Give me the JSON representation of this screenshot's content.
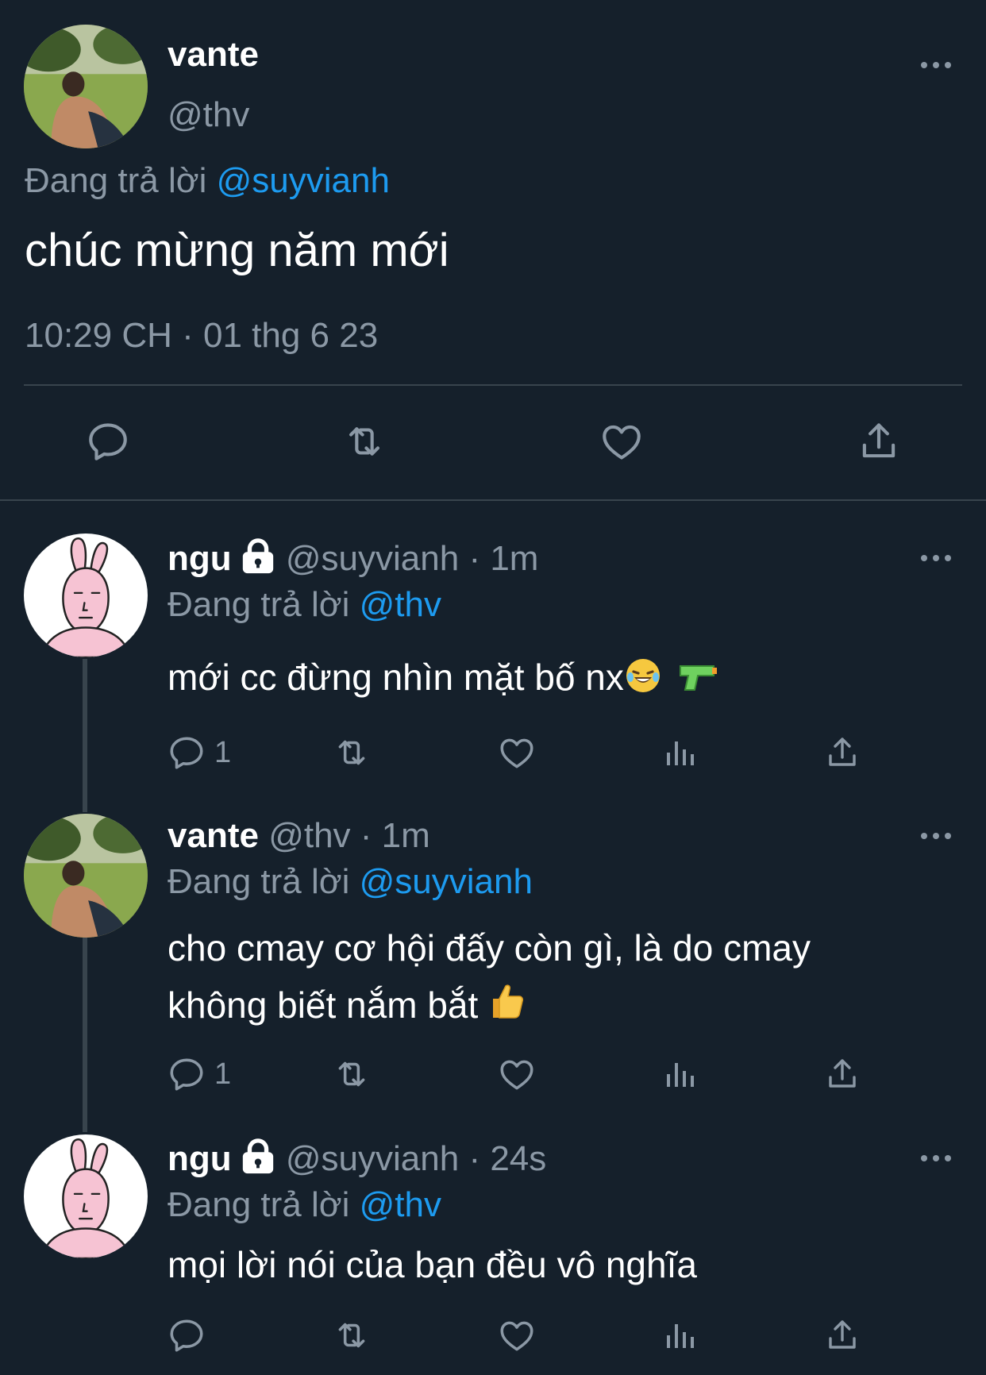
{
  "main_tweet": {
    "name": "vante",
    "handle": "@thv",
    "reply_prefix": "Đang trả lời",
    "reply_to": "@suyvianh",
    "text": "chúc mừng năm mới",
    "timestamp": "10:29 CH · 01 thg 6 23"
  },
  "replies": [
    {
      "name": "ngu",
      "handle": "@suyvianh",
      "time": "· 1m",
      "reply_prefix": "Đang trả lời",
      "reply_to": "@thv",
      "text": "mới cc đừng nhìn mặt bố nx",
      "emojis": [
        "face-with-tears-of-joy",
        "water-pistol"
      ],
      "reply_count": "1"
    },
    {
      "name": "vante",
      "handle": "@thv",
      "time": "· 1m",
      "reply_prefix": "Đang trả lời",
      "reply_to": "@suyvianh",
      "text_line1": "cho cmay cơ hội đấy còn gì, là do cmay",
      "text_line2": "không biết nắm bắt",
      "emojis": [
        "thumbs-up"
      ],
      "reply_count": "1"
    },
    {
      "name": "ngu",
      "handle": "@suyvianh",
      "time": "· 24s",
      "reply_prefix": "Đang trả lời",
      "reply_to": "@thv",
      "text": "mọi lời nói của bạn đều vô nghĩa"
    }
  ],
  "colors": {
    "background": "#15202b",
    "text": "#ffffff",
    "muted": "#8b98a5",
    "link": "#1d9bf0",
    "divider": "#38444d"
  }
}
